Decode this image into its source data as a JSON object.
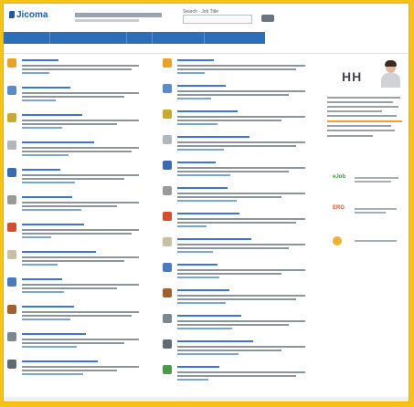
{
  "header": {
    "logo_text": "Jicoma",
    "search_label": "Search · Job Title"
  },
  "nav": {
    "items": [
      "",
      "",
      "",
      "",
      ""
    ]
  },
  "sidebar": {
    "ad_mark": "HH",
    "badge_labels": [
      "eJob",
      "ERG",
      ""
    ]
  },
  "colors": {
    "nav": "#2c6fb8",
    "link": "#1c5fb0",
    "frame": "#f6c21a"
  },
  "icons": {
    "col1": [
      "briefcase-icon",
      "dollar-icon",
      "lightbulb-icon",
      "document-icon",
      "car-icon",
      "pen-icon",
      "fire-icon",
      "paper-icon",
      "tools-icon",
      "stamp-icon",
      "building-icon",
      "bank-icon"
    ],
    "col2": [
      "globe-icon",
      "search-icon",
      "group-icon",
      "scales-icon",
      "dog-icon",
      "telescope-icon",
      "plane-icon",
      "crane-icon",
      "computer-icon",
      "coin-icon",
      "hand-icon",
      "lamp-icon",
      "book-icon"
    ]
  }
}
